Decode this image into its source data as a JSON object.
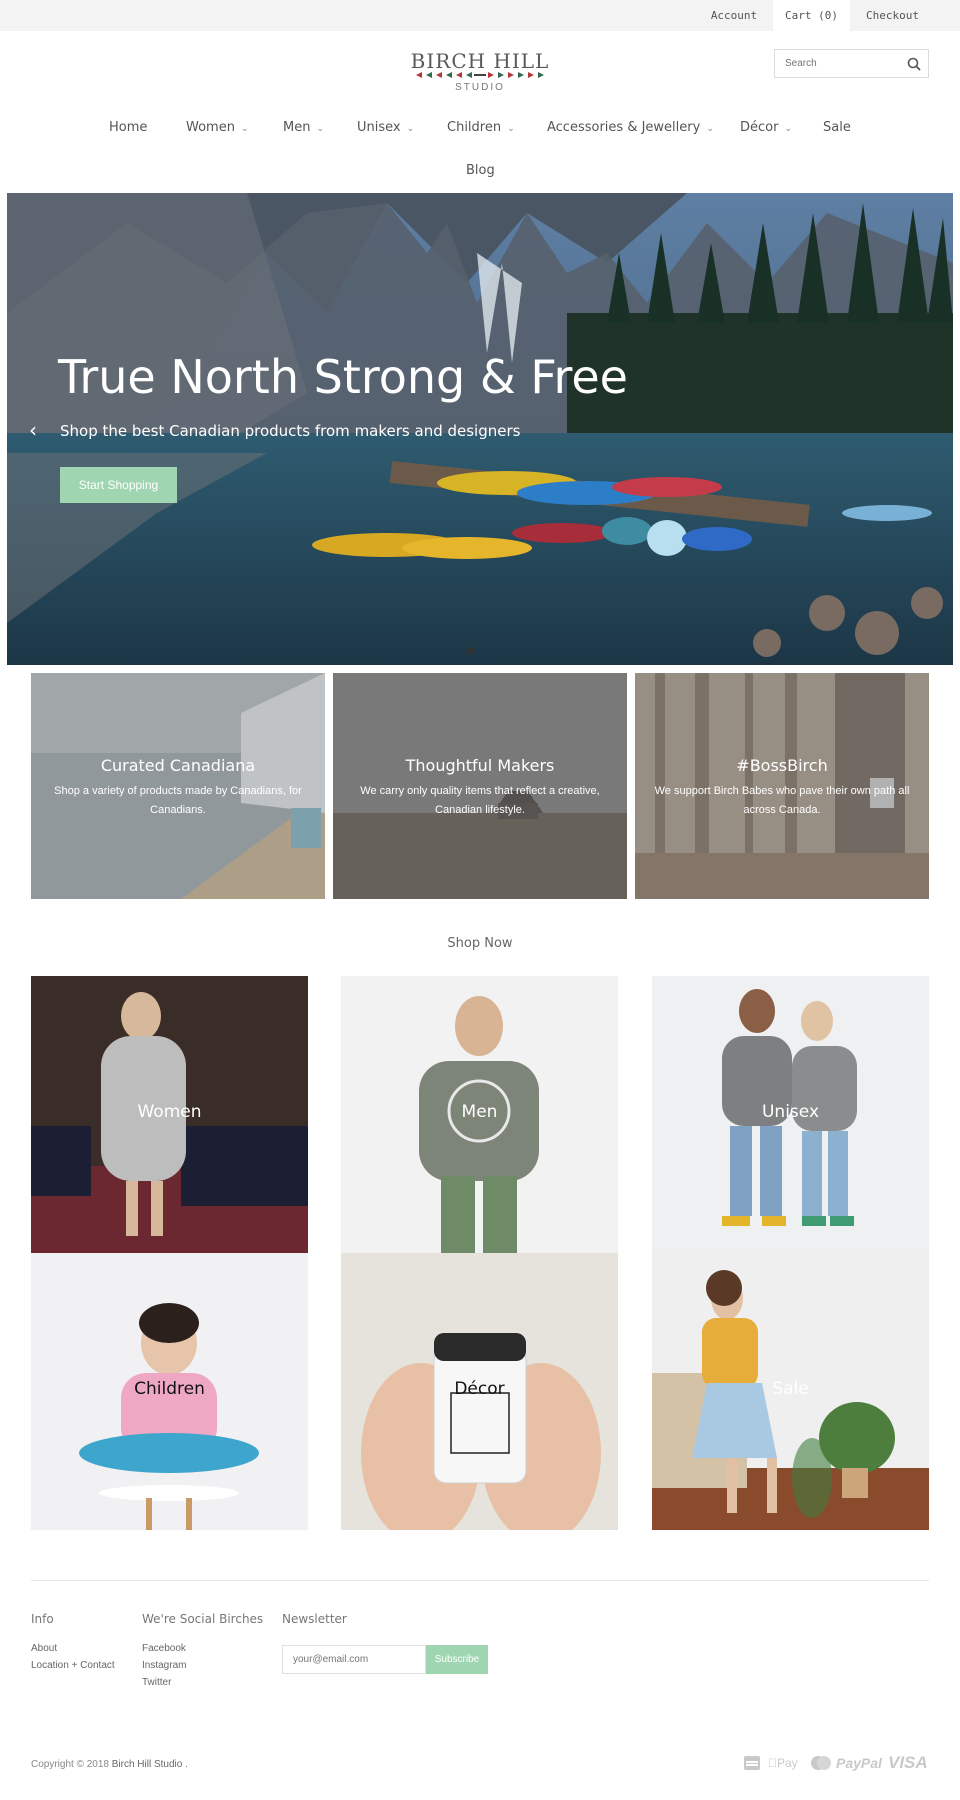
{
  "topbar": {
    "account": "Account",
    "cart": "Cart (0)",
    "checkout": "Checkout"
  },
  "logo": {
    "line1": "BIRCH HILL",
    "line2": "STUDIO"
  },
  "search": {
    "placeholder": "Search"
  },
  "nav": {
    "items": [
      "Home",
      "Women",
      "Men",
      "Unisex",
      "Children",
      "Accessories & Jewellery",
      "Décor",
      "Sale",
      "Blog"
    ]
  },
  "hero": {
    "title": "True North Strong & Free",
    "subtitle": "Shop the best Canadian products from makers and designers",
    "cta": "Start Shopping",
    "prev": "‹"
  },
  "features": [
    {
      "title": "Curated Canadiana",
      "text": "Shop a variety of products made by Canadians, for Canadians."
    },
    {
      "title": "Thoughtful Makers",
      "text": "We carry only quality items that reflect a creative, Canadian lifestyle."
    },
    {
      "title": "#BossBirch",
      "text": "We support Birch Babes who pave their own path all across Canada."
    }
  ],
  "shop_now": {
    "heading": "Shop Now",
    "categories": [
      "Women",
      "Men",
      "Unisex",
      "Children",
      "Décor",
      "Sale"
    ]
  },
  "footer": {
    "info": {
      "heading": "Info",
      "links": [
        "About",
        "Location + Contact"
      ]
    },
    "social": {
      "heading": "We're Social Birches",
      "links": [
        "Facebook",
        "Instagram",
        "Twitter"
      ]
    },
    "newsletter": {
      "heading": "Newsletter",
      "placeholder": "your@email.com",
      "button": "Subscribe"
    },
    "copyright_prefix": "Copyright © 2018",
    "copyright_link": "Birch Hill Studio",
    "copyright_suffix": ".",
    "payment_icons": [
      "amex-icon",
      "apple-pay-icon",
      "mastercard-icon",
      "paypal-icon",
      "visa-icon"
    ],
    "payment_labels": {
      "apple_pay": "Pay",
      "paypal": "PayPal",
      "visa": "VISA"
    }
  },
  "colors": {
    "accent": "#9fd6b1",
    "topbar_bg": "#f3f3f3",
    "text": "#555555"
  }
}
